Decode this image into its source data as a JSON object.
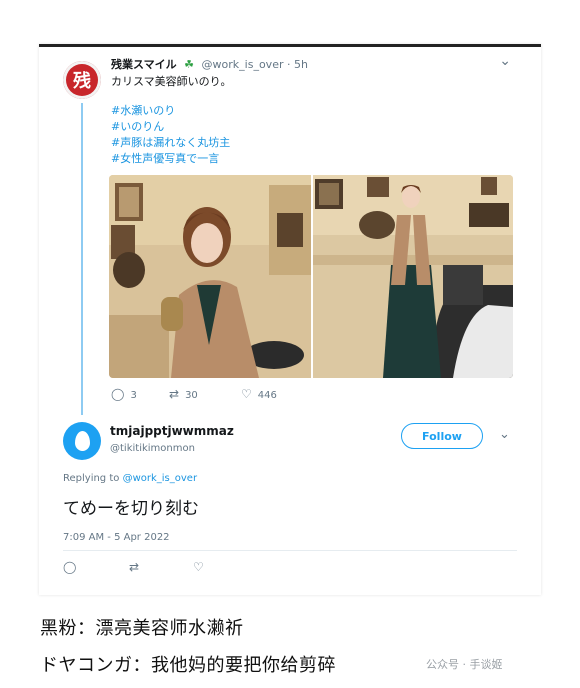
{
  "tweet1": {
    "avatar_glyph": "残",
    "display_name": "残業スマイル",
    "badge_icon": "clover-icon",
    "handle": "@work_is_over",
    "separator": "·",
    "time_ago": "5h",
    "text": "カリスマ美容師いのり。",
    "hashtags": [
      "#水瀬いのり",
      "#いのりん",
      "#声豚は漏れなく丸坊主",
      "#女性声優写真で一言"
    ],
    "actions": {
      "reply_count": "3",
      "retweet_count": "30",
      "like_count": "446"
    }
  },
  "tweet2": {
    "display_name": "tmjajpptjwwmmaz",
    "handle": "@tikitikimonmon",
    "follow_label": "Follow",
    "replying_prefix": "Replying to",
    "replying_handle": "@work_is_over",
    "text": "てめーを切り刻む",
    "timestamp": "7:09 AM - 5 Apr 2022"
  },
  "captions": {
    "line1": "黑粉：漂亮美容师水濑祈",
    "line2": "ドヤコンガ：我他妈的要把你给剪碎"
  },
  "watermark": "公众号 · 手谈姬",
  "colors": {
    "link_blue": "#1b95e0",
    "follow_blue": "#1da1f2",
    "avatar_red": "#c8262b",
    "thread_line": "#8ecbf2",
    "muted_gray": "#657786"
  }
}
